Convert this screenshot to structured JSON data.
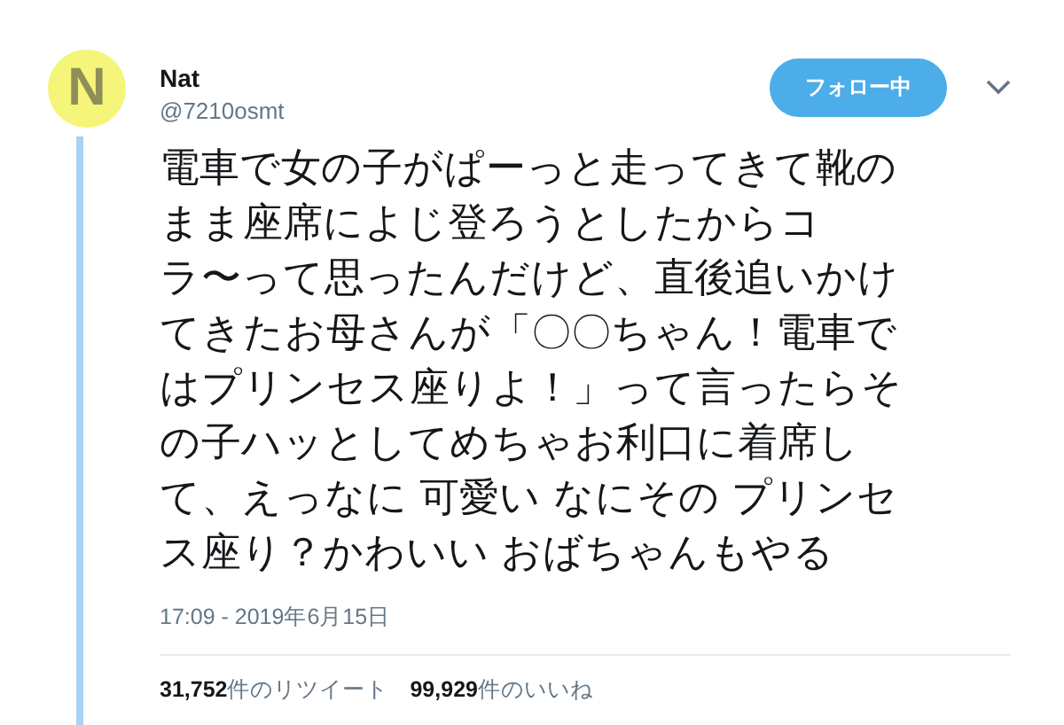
{
  "tweet": {
    "author": {
      "avatar_letter": "N",
      "name": "Nat",
      "handle": "@7210osmt"
    },
    "follow_button": {
      "label": "フォロー中",
      "following": true
    },
    "text_lines": [
      "電車で女の子がぱーっと走ってきて靴の",
      "まま座席によじ登ろうとしたからコ",
      "ラ〜って思ったんだけど、直後追いかけ",
      "てきたお母さんが「〇〇ちゃん！電車で",
      "はプリンセス座りよ！」って言ったらそ",
      "の子ハッとしてめちゃお利口に着席し",
      "て、えっなに 可愛い なにその プリンセ",
      "ス座り？かわいい おばちゃんもやる"
    ],
    "timestamp": "17:09 - 2019年6月15日",
    "stats": [
      {
        "text": "**31,752**件のリツイート"
      },
      {
        "text": "**99,929**件のいいね"
      }
    ]
  }
}
